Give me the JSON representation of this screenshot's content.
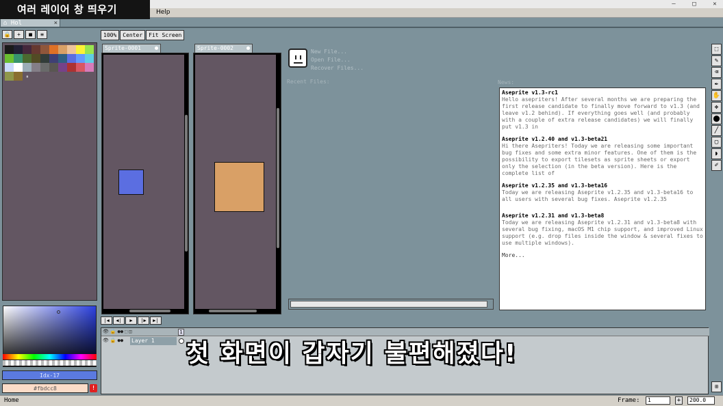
{
  "window": {
    "minimize": "—",
    "maximize": "□",
    "close": "✕"
  },
  "menu": {
    "help": "Help"
  },
  "caption_top": "여러 레이어 창 띄우기",
  "home_tab": {
    "icon": "⌂",
    "label": "Hol",
    "close": "×"
  },
  "left_tools": [
    "🔒",
    "+",
    "■",
    "≡"
  ],
  "palette_colors": [
    "#1a1a1a",
    "#222034",
    "#45283c",
    "#663931",
    "#8f563b",
    "#df7126",
    "#d9a066",
    "#eec39a",
    "#fbf236",
    "#99e550",
    "#6abe30",
    "#37946e",
    "#4b692f",
    "#524b24",
    "#323c39",
    "#3f3f74",
    "#306082",
    "#5b6ee1",
    "#639bff",
    "#5fcde4",
    "#cbdbfc",
    "#ffffff",
    "#9badb7",
    "#847e87",
    "#696a6a",
    "#595652",
    "#76428a",
    "#ac3232",
    "#d95763",
    "#d77bba",
    "#8f974a",
    "#8a6f30"
  ],
  "palette_extra": "⏸",
  "color_index": "Idx-17",
  "hex_value": "#fbdcc8",
  "warn": "!",
  "zoom_buttons": [
    "100%",
    "Center",
    "Fit Screen"
  ],
  "sprites": [
    {
      "tab": "Sprite-0001",
      "color": "#5b6ee1"
    },
    {
      "tab": "Sprite-0002",
      "color": "#d9a066"
    }
  ],
  "home": {
    "links": [
      "New File...",
      "Open File...",
      "Recover Files..."
    ],
    "recent_label": "Recent Files:",
    "news_label": "News:",
    "news": [
      {
        "title": "Aseprite v1.3-rc1",
        "body": "Hello asepriters! After several months we are preparing the first release candidate to finally move forward to v1.3 (and leave v1.2 behind). If everything goes well (and probably with a couple of extra release candidates) we will finally put v1.3 in"
      },
      {
        "title": "Aseprite v1.2.40 and v1.3-beta21",
        "body": "Hi there Asepriters! Today we are releasing some important bug fixes and some extra minor features. One of them is the possibility to export tilesets as sprite sheets or export only the selection (in the beta version). Here is the complete list of"
      },
      {
        "title": "Aseprite v1.2.35 and v1.3-beta16",
        "body": "Today we are releasing Aseprite v1.2.35 and v1.3-beta16 to all users with several bug fixes. Aseprite v1.2.35"
      },
      {
        "title": "Aseprite v1.2.31 and v1.3-beta8",
        "body": "Today we are releasing Aseprite v1.2.31 and v1.3-beta8 with several bug fixing, macOS M1 chip support, and improved Linux support (e.g. drop files inside the window & several fixes to use multiple windows)."
      }
    ],
    "more": "More...",
    "progress_fraction": 0.98
  },
  "timeline": {
    "controls": [
      "|◀",
      "◀|",
      "▶",
      "|▶",
      "▶|"
    ],
    "header_icons": [
      "👁",
      "🔒",
      "●●",
      "⬚",
      "◫"
    ],
    "row_icons": [
      "👁",
      "🔒",
      "●●"
    ],
    "frame_number": "1",
    "layer_name": "Layer 1"
  },
  "big_caption": "첫 화면이 갑자기 불편해졌다!",
  "right_tools": [
    "⬚",
    "✎",
    "⌫",
    "✒",
    "✋",
    "✥",
    "⬤",
    "╱",
    "▢",
    "◗",
    "✐"
  ],
  "right_bottom": "⊞",
  "status": {
    "text": "Home",
    "frame_label": "Frame:",
    "frame_value": "1",
    "add": "+",
    "zoom": "200.0"
  }
}
